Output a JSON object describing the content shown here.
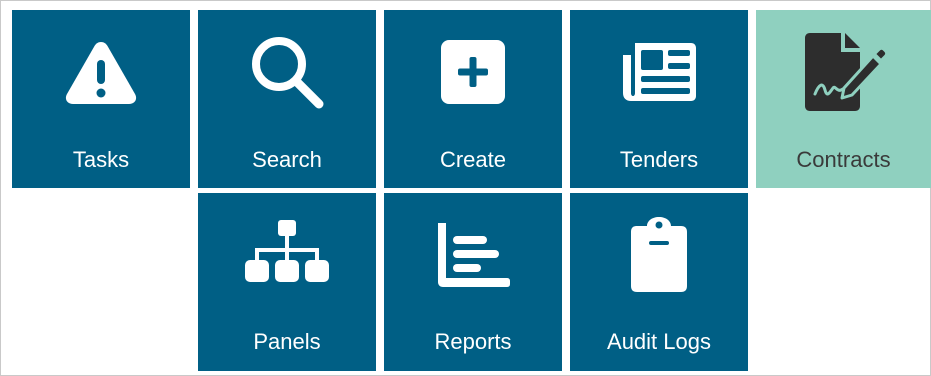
{
  "tiles": [
    {
      "label": "Tasks",
      "icon": "warning-triangle-icon"
    },
    {
      "label": "Search",
      "icon": "search-icon"
    },
    {
      "label": "Create",
      "icon": "plus-square-icon"
    },
    {
      "label": "Tenders",
      "icon": "newspaper-icon"
    },
    {
      "label": "Contracts",
      "icon": "file-signature-icon",
      "active": true
    },
    {
      "label": "Panels",
      "icon": "sitemap-icon"
    },
    {
      "label": "Reports",
      "icon": "bar-chart-icon"
    },
    {
      "label": "Audit Logs",
      "icon": "clipboard-icon"
    }
  ],
  "colors": {
    "tile": "#005f85",
    "tile_active": "#8fd0bf",
    "label": "#ffffff",
    "label_active": "#3a3a3a"
  }
}
